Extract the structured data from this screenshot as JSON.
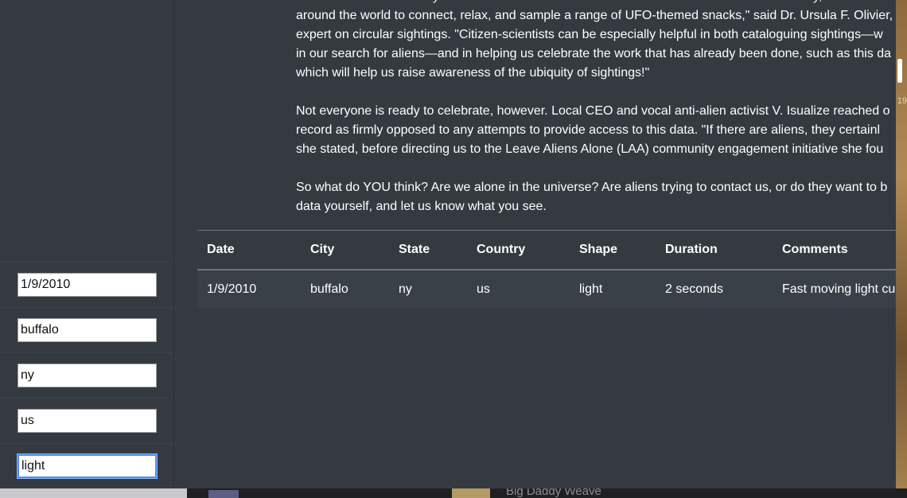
{
  "article": {
    "paragraphs": [
      {
        "lines": [
          "\"The release of this analysis is well-timed. It coincides with the celebration of World UFO Day, which is a",
          "around the world to connect, relax, and sample a range of UFO-themed snacks,\" said Dr. Ursula F. Olivier,",
          "expert on circular sightings. \"Citizen-scientists can be especially helpful in both cataloguing sightings—w",
          "in our search for aliens—and in helping us celebrate the work that has already been done, such as this da",
          "which will help us raise awareness of the ubiquity of sightings!\""
        ]
      },
      {
        "lines": [
          "Not everyone is ready to celebrate, however. Local CEO and vocal anti-alien activist V. Isualize reached o",
          "record as firmly opposed to any attempts to provide access to this data. \"If there are aliens, they certainl",
          "she stated, before directing us to the Leave Aliens Alone (LAA) community engagement initiative she fou"
        ]
      },
      {
        "lines": [
          "So what do YOU think? Are we alone in the universe? Are aliens trying to contact us, or do they want to b",
          "data yourself, and let us know what you see."
        ]
      }
    ]
  },
  "filters": [
    {
      "value": "1/9/2010"
    },
    {
      "value": "buffalo"
    },
    {
      "value": "ny"
    },
    {
      "value": "us"
    },
    {
      "value": "light"
    }
  ],
  "table": {
    "headers": [
      "Date",
      "City",
      "State",
      "Country",
      "Shape",
      "Duration",
      "Comments"
    ],
    "rows": [
      [
        "1/9/2010",
        "buffalo",
        "ny",
        "us",
        "light",
        "2 seconds",
        "Fast moving light cu"
      ]
    ]
  },
  "desktop": {
    "side_badge": "19",
    "dock_title": "Big Daddy Weave"
  }
}
